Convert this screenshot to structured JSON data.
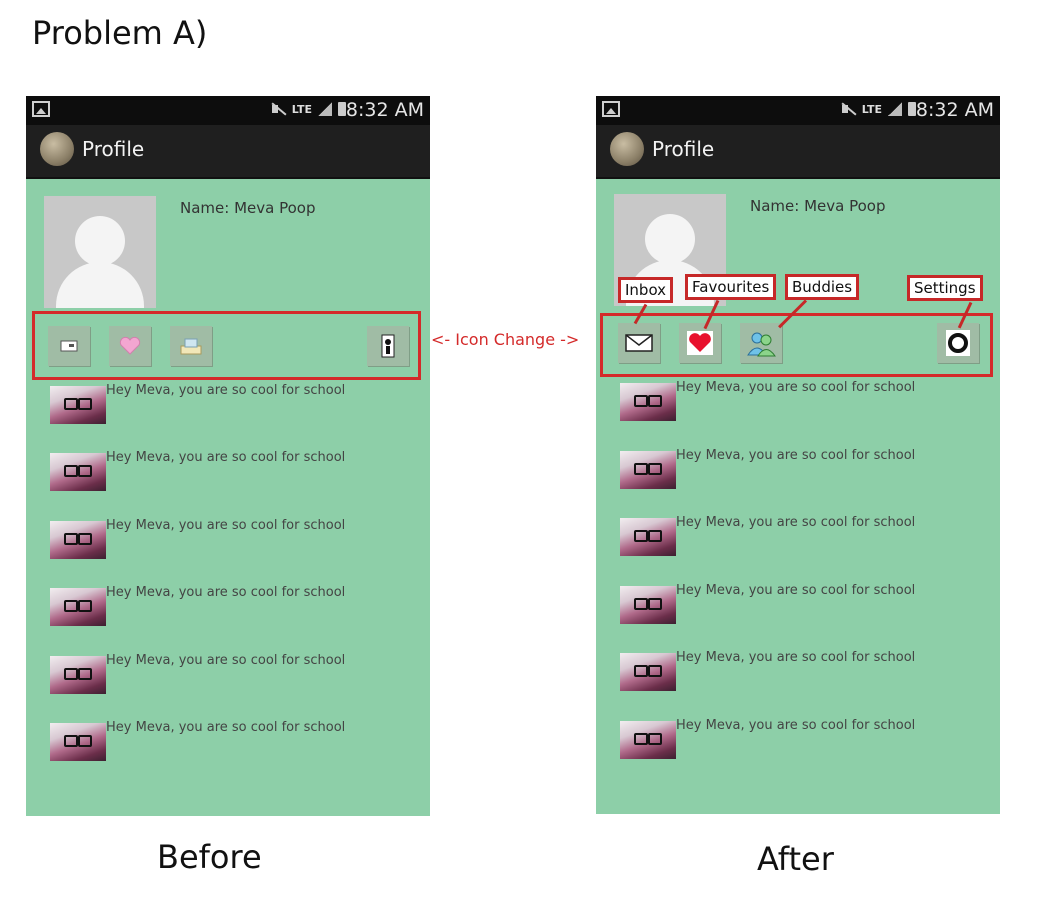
{
  "page_title": "Problem A)",
  "middle_label": "<- Icon Change ->",
  "captions": {
    "before": "Before",
    "after": "After"
  },
  "status_bar": {
    "network": "LTE",
    "time": "8:32 AM"
  },
  "action_bar": {
    "title": "Profile"
  },
  "profile": {
    "name_label": "Name: Meva Poop"
  },
  "icons_before": [
    "envelope-small-icon",
    "heart-small-icon",
    "buddies-small-icon",
    "settings-small-icon"
  ],
  "icons_after": [
    "envelope-icon",
    "heart-icon",
    "buddies-icon",
    "settings-gear-icon"
  ],
  "callouts": {
    "inbox": "Inbox",
    "favourites": "Favourites",
    "buddies": "Buddies",
    "settings": "Settings"
  },
  "messages": [
    "Hey Meva, you are so cool for school",
    "Hey Meva, you are so cool for school",
    "Hey Meva, you are so cool for school",
    "Hey Meva, you are so cool for school",
    "Hey Meva, you are so cool for school",
    "Hey Meva, you are so cool for school"
  ],
  "colors": {
    "app_background": "#8dcfa8",
    "highlight_red": "#d42a2a",
    "action_bar": "#1f1f1f",
    "status_bar": "#0d0d0d"
  }
}
